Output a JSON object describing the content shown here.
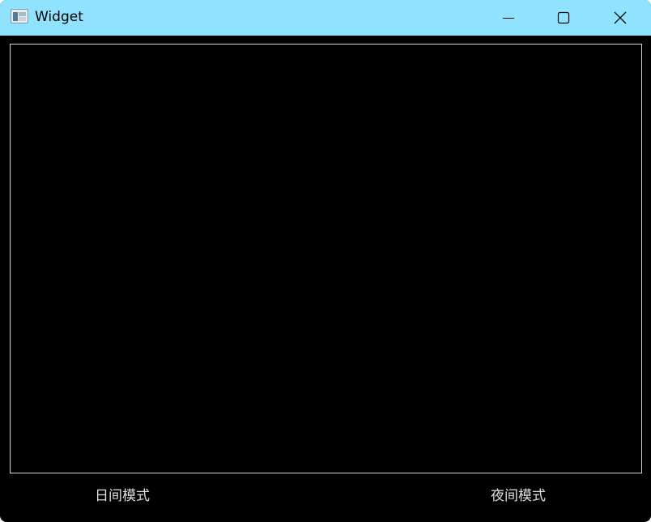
{
  "window": {
    "title": "Widget",
    "app_icon": "app-window-icon"
  },
  "titlebar_buttons": {
    "minimize_icon": "minimize-icon",
    "maximize_icon": "maximize-icon",
    "close_icon": "close-icon"
  },
  "main": {
    "day_mode_label": "日间模式",
    "night_mode_label": "夜间模式"
  },
  "colors": {
    "titlebar_bg": "#8fe3ff",
    "window_bg": "#000000",
    "canvas_border": "#d8d8d8",
    "button_text": "#e0e0e0"
  }
}
